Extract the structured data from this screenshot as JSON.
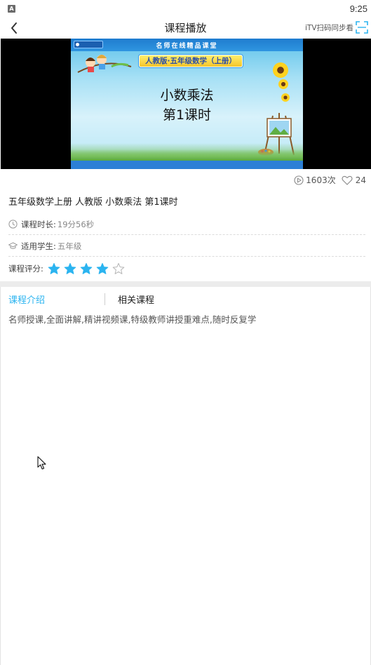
{
  "status_bar": {
    "time": "9:25",
    "app_icon_letter": "A"
  },
  "header": {
    "title": "课程播放",
    "itv_label": "iTV扫码同步看",
    "back_icon": "chevron-left-icon",
    "scan_icon": "scan-frame-icon"
  },
  "video": {
    "top_banner": "名师在线精品课堂",
    "grade_banner": "人教版·五年级数学（上册）",
    "lesson_line1": "小数乘法",
    "lesson_line2": "第1课时"
  },
  "stats": {
    "play_count": "1603次",
    "likes": "24"
  },
  "course": {
    "title": "五年级数学上册 人教版 小数乘法 第1课时",
    "duration_label": "课程时长:",
    "duration_value": "19分56秒",
    "students_label": "适用学生:",
    "students_value": "五年级",
    "rating_label": "课程评分:",
    "rating_filled": 4,
    "rating_max": 5
  },
  "tabs": {
    "intro": "课程介绍",
    "related": "相关课程"
  },
  "description": "名师授课,全面讲解,精讲视频课,特级教师讲授重难点,随时反复学",
  "colors": {
    "accent": "#2bb4f0",
    "star": "#2bb4f0"
  }
}
